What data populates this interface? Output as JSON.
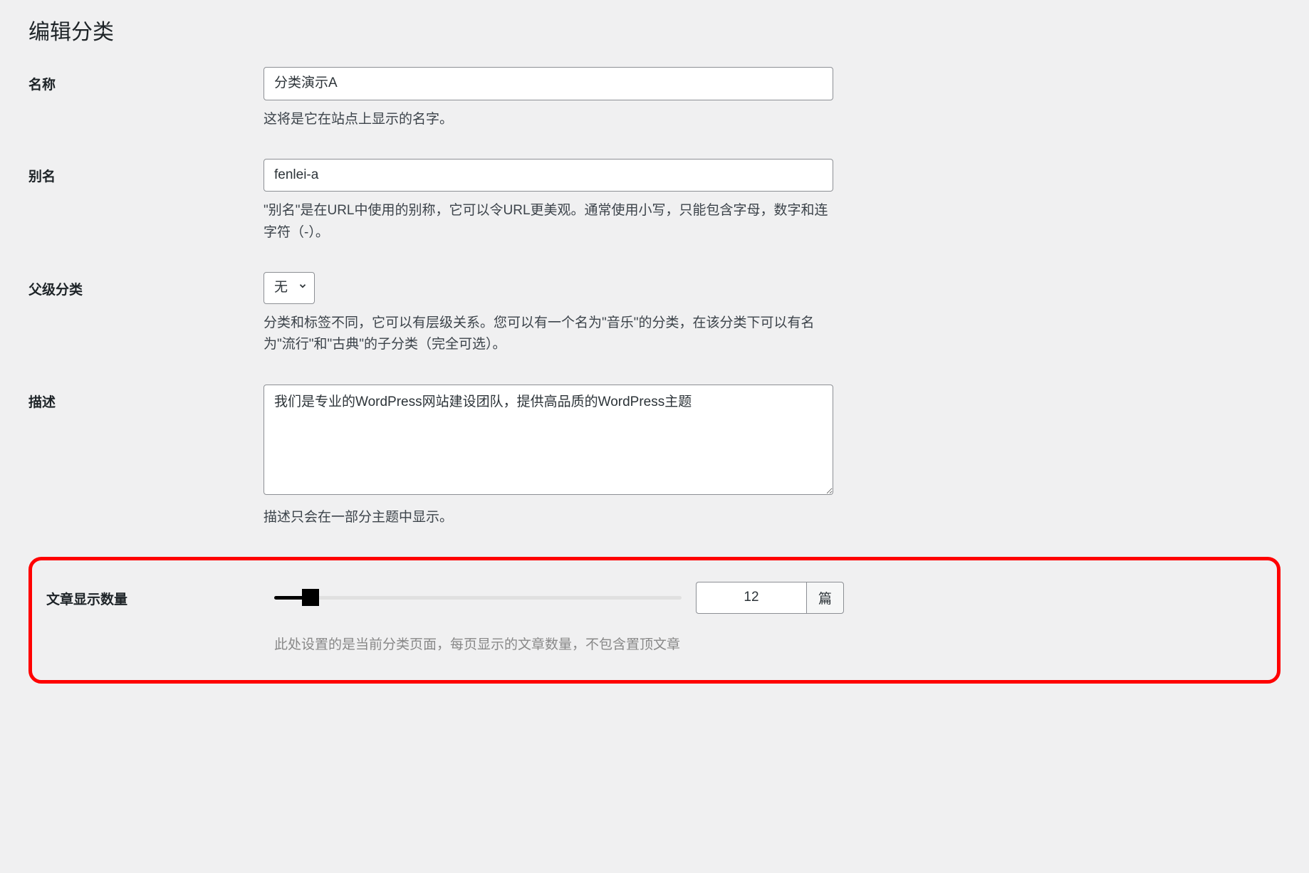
{
  "page": {
    "title": "编辑分类"
  },
  "fields": {
    "name": {
      "label": "名称",
      "value": "分类演示A",
      "help": "这将是它在站点上显示的名字。"
    },
    "slug": {
      "label": "别名",
      "value": "fenlei-a",
      "help": "\"别名\"是在URL中使用的别称，它可以令URL更美观。通常使用小写，只能包含字母，数字和连字符（-）。"
    },
    "parent": {
      "label": "父级分类",
      "selected": "无",
      "help": "分类和标签不同，它可以有层级关系。您可以有一个名为\"音乐\"的分类，在该分类下可以有名为\"流行\"和\"古典\"的子分类（完全可选）。"
    },
    "description": {
      "label": "描述",
      "value": "我们是专业的WordPress网站建设团队，提供高品质的WordPress主题",
      "help": "描述只会在一部分主题中显示。"
    },
    "post_count": {
      "label": "文章显示数量",
      "value": "12",
      "suffix": "篇",
      "help": "此处设置的是当前分类页面，每页显示的文章数量，不包含置顶文章"
    }
  }
}
